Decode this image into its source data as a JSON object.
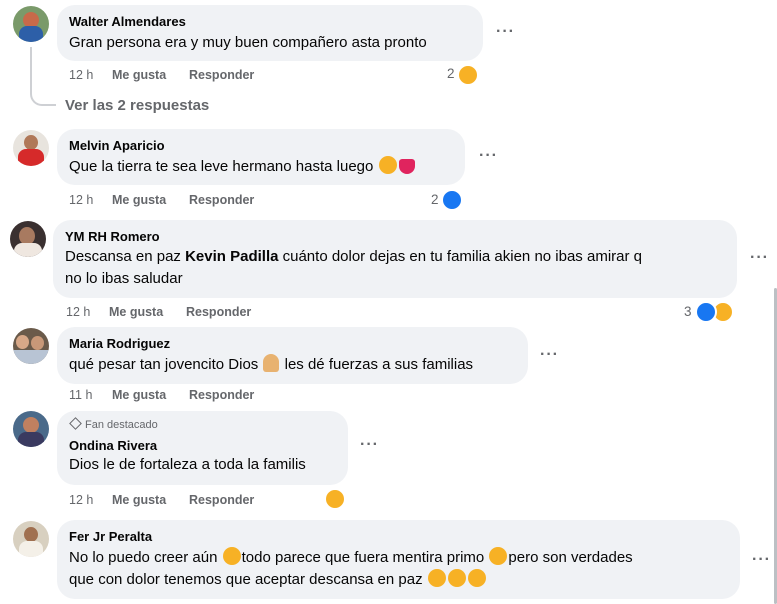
{
  "comments": [
    {
      "author": "Walter Almendares",
      "text": "Gran persona era y muy buen compañero asta pronto",
      "time": "12 h",
      "like": "Me gusta",
      "reply": "Responder",
      "reaction_count": "2",
      "reactions": [
        "sad"
      ]
    },
    {
      "author": "Melvin Aparicio",
      "text": "Que la tierra te sea leve hermano hasta luego",
      "time": "12 h",
      "like": "Me gusta",
      "reply": "Responder",
      "reaction_count": "2",
      "reactions": [
        "like"
      ]
    },
    {
      "author": "YM RH Romero",
      "text_a": "Descansa en paz ",
      "mention": "Kevin Padilla",
      "text_b": " cuánto dolor dejas en tu familia akien no ibas amirar q",
      "text_c": "no lo ibas saludar",
      "time": "12 h",
      "like": "Me gusta",
      "reply": "Responder",
      "reaction_count": "3",
      "reactions": [
        "like",
        "sad"
      ]
    },
    {
      "author": "Maria Rodriguez",
      "text_a": "qué pesar tan jovencito Dios",
      "text_b": "les dé fuerzas a sus familias",
      "time": "11 h",
      "like": "Me gusta",
      "reply": "Responder"
    },
    {
      "badge": "Fan destacado",
      "author": "Ondina Rivera",
      "text": "Dios le de fortaleza a toda la familis",
      "time": "12 h",
      "like": "Me gusta",
      "reply": "Responder",
      "reactions": [
        "sad"
      ]
    },
    {
      "author": "Fer Jr Peralta",
      "text_a": "No lo puedo creer aún",
      "text_b": "todo parece que fuera mentira primo",
      "text_c": "pero son verdades",
      "text_d": "que con dolor tenemos que aceptar descansa en paz"
    }
  ],
  "view_replies": "Ver las 2 respuestas",
  "more_glyph": "···",
  "colors": {
    "bubble": "#f0f2f5",
    "meta": "#65676b",
    "like": "#1877f2",
    "sad": "#f7b125"
  }
}
